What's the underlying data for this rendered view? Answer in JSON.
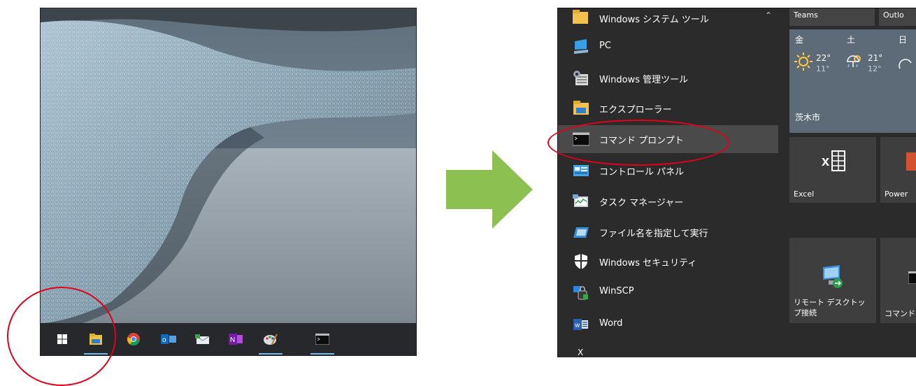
{
  "desktop": {
    "taskbar_icons": [
      "windows-start-icon",
      "file-explorer-icon",
      "chrome-icon",
      "outlook-icon",
      "mail-icon",
      "onenote-icon",
      "paint-icon",
      "command-prompt-icon"
    ]
  },
  "start_menu": {
    "group_header": "Windows システム ツール",
    "items": [
      {
        "label": "PC",
        "icon": "pc-icon"
      },
      {
        "label": "Windows 管理ツール",
        "icon": "admin-tools-icon"
      },
      {
        "label": "エクスプローラー",
        "icon": "folder-icon"
      },
      {
        "label": "コマンド プロンプト",
        "icon": "command-prompt-icon"
      },
      {
        "label": "コントロール パネル",
        "icon": "control-panel-icon"
      },
      {
        "label": "タスク マネージャー",
        "icon": "task-manager-icon"
      },
      {
        "label": "ファイル名を指定して実行",
        "icon": "run-icon"
      },
      {
        "label": "Windows セキュリティ",
        "icon": "shield-icon"
      },
      {
        "label": "WinSCP",
        "icon": "winscp-icon"
      },
      {
        "label": "Word",
        "icon": "word-icon"
      }
    ],
    "next_letter": "X",
    "tiles": {
      "teams": "Teams",
      "outlook": "Outlo",
      "weather": {
        "days": [
          "金",
          "土",
          "日"
        ],
        "hi": [
          "22°",
          "21°"
        ],
        "lo": [
          "11°",
          "12°"
        ],
        "city": "茨木市"
      },
      "excel": "Excel",
      "powerpoint": "Power",
      "remote_desktop_line1": "リモート デスクトッ",
      "remote_desktop_line2": "プ接続",
      "cmd_tile": "コマンド"
    }
  },
  "colors": {
    "highlight": "#e3001b",
    "arrow": "#8cc152",
    "menu_bg": "#2b2b2b",
    "taskbar_bg": "#26282b"
  }
}
